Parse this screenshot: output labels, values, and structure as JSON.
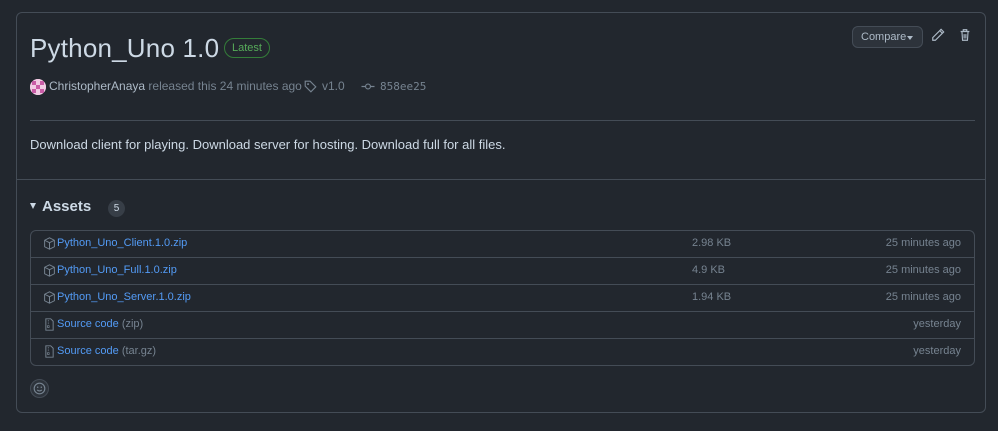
{
  "release": {
    "title": "Python_Uno 1.0",
    "badge": "Latest",
    "compare_label": "Compare",
    "author": "ChristopherAnaya",
    "released_text": "released this 24 minutes ago",
    "tag": "v1.0",
    "commit": "858ee25",
    "description": "Download client for playing. Download server for hosting. Download full for all files."
  },
  "assets": {
    "heading": "Assets",
    "count": "5",
    "rows": [
      {
        "name": "Python_Uno_Client.1.0.zip",
        "suffix": "",
        "size": "2.98 KB",
        "time": "25 minutes ago",
        "icon": "package-icon"
      },
      {
        "name": "Python_Uno_Full.1.0.zip",
        "suffix": "",
        "size": "4.9 KB",
        "time": "25 minutes ago",
        "icon": "package-icon"
      },
      {
        "name": "Python_Uno_Server.1.0.zip",
        "suffix": "",
        "size": "1.94 KB",
        "time": "25 minutes ago",
        "icon": "package-icon"
      },
      {
        "name": "Source code",
        "suffix": "(zip)",
        "size": "",
        "time": "yesterday",
        "icon": "file-zip-icon"
      },
      {
        "name": "Source code",
        "suffix": "(tar.gz)",
        "size": "",
        "time": "yesterday",
        "icon": "file-zip-icon"
      }
    ]
  },
  "colors": {
    "background": "#22272e",
    "border": "#444c56",
    "link": "#539bf5",
    "success": "#57ab5a",
    "text": "#adbac7",
    "muted": "#768390"
  }
}
